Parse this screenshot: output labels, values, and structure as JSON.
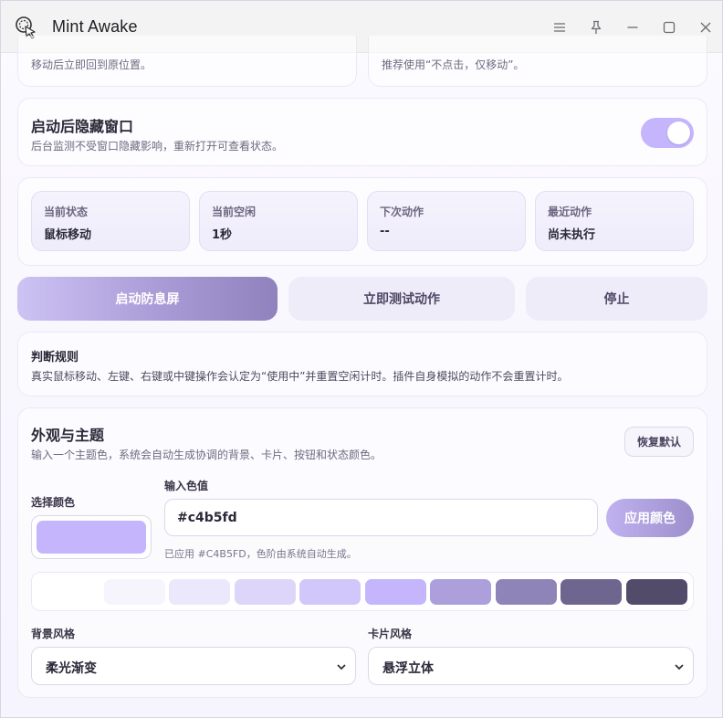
{
  "titlebar": {
    "title": "Mint Awake",
    "icons": [
      "menu-icon",
      "pin-icon",
      "minimize-icon",
      "maximize-icon",
      "close-icon"
    ]
  },
  "top_partial": {
    "left_text": "移动后立即回到原位置。",
    "right_text": "推荐使用“不点击，仅移动”。"
  },
  "hide_window": {
    "title": "启动后隐藏窗口",
    "desc": "后台监测不受窗口隐藏影响，重新打开可查看状态。",
    "toggle_on": true
  },
  "status": [
    {
      "label": "当前状态",
      "value": "鼠标移动"
    },
    {
      "label": "当前空闲",
      "value": "1秒"
    },
    {
      "label": "下次动作",
      "value": "--"
    },
    {
      "label": "最近动作",
      "value": "尚未执行"
    }
  ],
  "actions": {
    "start": "启动防息屏",
    "test": "立即测试动作",
    "stop": "停止"
  },
  "rules": {
    "title": "判断规则",
    "desc": "真实鼠标移动、左键、右键或中键操作会认定为“使用中”并重置空闲计时。插件自身模拟的动作不会重置计时。"
  },
  "theme": {
    "title": "外观与主题",
    "desc": "输入一个主题色，系统会自动生成协调的背景、卡片、按钮和状态颜色。",
    "reset_label": "恢复默认",
    "pick_label": "选择颜色",
    "input_label": "输入色值",
    "input_value": "#c4b5fd",
    "apply_label": "应用颜色",
    "applied_hint": "已应用 #C4B5FD，色阶由系统自动生成。",
    "selected_color": "#c4b5fd",
    "palette": [
      "#ffffff",
      "#f6f4fd",
      "#ece8fb",
      "#ded6fa",
      "#d1c7fb",
      "#c4b5fd",
      "#ac9fdc",
      "#8f84b8",
      "#6f6690",
      "#534b6a"
    ],
    "bg_style_label": "背景风格",
    "bg_style_value": "柔光渐变",
    "card_style_label": "卡片风格",
    "card_style_value": "悬浮立体"
  }
}
